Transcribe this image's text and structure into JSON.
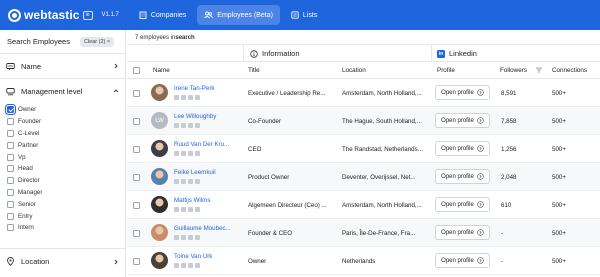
{
  "app": {
    "logo_text": "webtastic",
    "logo_badge": "io",
    "version": "V1.1.7"
  },
  "nav": [
    {
      "label": "Companies",
      "icon": "building-icon",
      "active": false
    },
    {
      "label": "Employees (Beta)",
      "icon": "people-icon",
      "active": true
    },
    {
      "label": "Lists",
      "icon": "list-icon",
      "active": false
    }
  ],
  "sidebar": {
    "title": "Search Employees",
    "clear_label": "Clear (2)",
    "clear_close": "×",
    "sections": {
      "name": "Name",
      "management": "Management level",
      "location": "Location"
    },
    "management_options": [
      {
        "label": "Owner",
        "checked": true
      },
      {
        "label": "Founder",
        "checked": false
      },
      {
        "label": "C-Level",
        "checked": false
      },
      {
        "label": "Partner",
        "checked": false
      },
      {
        "label": "Vp",
        "checked": false
      },
      {
        "label": "Head",
        "checked": false
      },
      {
        "label": "Director",
        "checked": false
      },
      {
        "label": "Manager",
        "checked": false
      },
      {
        "label": "Senior",
        "checked": false
      },
      {
        "label": "Entry",
        "checked": false
      },
      {
        "label": "Intern",
        "checked": false
      }
    ]
  },
  "results": {
    "count_prefix": "7 employees in ",
    "count_bold": "search"
  },
  "groups": {
    "information": "Information",
    "linkedin_badge": "in",
    "linkedin": "Linkedin"
  },
  "columns": {
    "name": "Name",
    "title": "Title",
    "location": "Location",
    "profile": "Profile",
    "followers": "Followers",
    "connections": "Connections"
  },
  "open_profile_label": "Open profile",
  "rows": [
    {
      "name": "Irene Tan-Perk",
      "title": "Executive / Leadership Re...",
      "location": "Amsterdam, North Holland,...",
      "followers": "8,591",
      "connections": "500+",
      "avatar": "photo",
      "avatar_color": "#8a6a52"
    },
    {
      "name": "Lee Willoughby",
      "title": "Co-Founder",
      "location": "The Hague, South Holland,...",
      "followers": "7,858",
      "connections": "500+",
      "avatar": "initials",
      "initials": "LW",
      "avatar_color": "#b5bac2"
    },
    {
      "name": "Ruud Van Der Kru...",
      "title": "CEO",
      "location": "The Randstad, Netherlands...",
      "followers": "1,256",
      "connections": "500+",
      "avatar": "photo",
      "avatar_color": "#3d3f48"
    },
    {
      "name": "Feike Leemkuil",
      "title": "Product Owner",
      "location": "Deventer, Overijssel, Net...",
      "followers": "2,048",
      "connections": "500+",
      "avatar": "photo",
      "avatar_color": "#5b7fae"
    },
    {
      "name": "Mattijs Wilms",
      "title": "Algemeen Directeur (Ceo) ...",
      "location": "Amsterdam, North Holland,...",
      "followers": "610",
      "connections": "500+",
      "avatar": "photo",
      "avatar_color": "#2e2e33"
    },
    {
      "name": "Guillaume Moubec...",
      "title": "Founder & CEO",
      "location": "Paris, Île-De-France, Fra...",
      "followers": "-",
      "connections": "500+",
      "avatar": "photo",
      "avatar_color": "#c98b6a"
    },
    {
      "name": "Toine Van Urk",
      "title": "Owner",
      "location": "Netherlands",
      "followers": "-",
      "connections": "500+",
      "avatar": "photo",
      "avatar_color": "#4a4038"
    }
  ]
}
